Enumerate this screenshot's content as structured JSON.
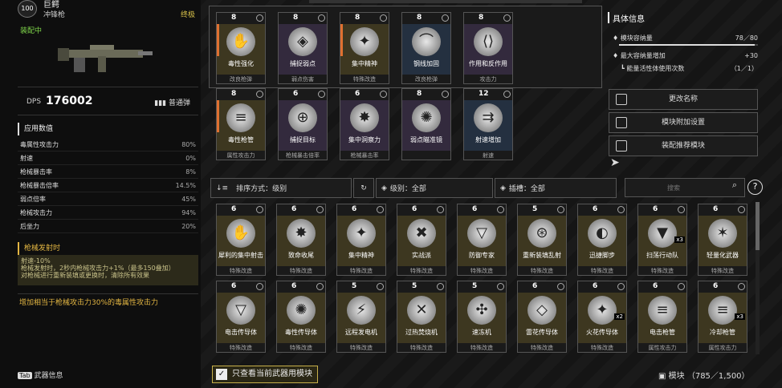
{
  "weapon": {
    "level": "100",
    "name": "巨鳄",
    "type": "冲锋枪",
    "rank": "终极",
    "equipped": "装配中",
    "dps_label": "DPS",
    "dps_value": "176002",
    "ammo": "普通弹"
  },
  "stats": {
    "title": "应用数值",
    "rows": [
      {
        "label": "毒属性攻击力",
        "value": "80%"
      },
      {
        "label": "射速",
        "value": "0%"
      },
      {
        "label": "枪械暴击率",
        "value": "8%"
      },
      {
        "label": "枪械暴击倍率",
        "value": "14.5%"
      },
      {
        "label": "弱点倍率",
        "value": "45%"
      },
      {
        "label": "枪械攻击力",
        "value": "94%"
      },
      {
        "label": "后坐力",
        "value": "20%"
      }
    ]
  },
  "fire": {
    "title": "枪械发射时",
    "line1": "射速-10%",
    "line2": "枪械发射时，2秒内枪械攻击力+1%（最多150叠加）",
    "line3": "对枪械进行重新装填或更换时，清除所有效果"
  },
  "poison_note": "增加相当于枪械攻击力30%的毒属性攻击力",
  "tab_key": "Tab",
  "tab_label": "武器信息",
  "equipped_mods": [
    {
      "cost": "8",
      "name": "毒性强化",
      "cat": "改良枪弹",
      "c": "gold",
      "icon": "✋"
    },
    {
      "cost": "8",
      "name": "捕捉弱点",
      "cat": "弱点伤害",
      "c": "purple",
      "icon": "◈"
    },
    {
      "cost": "8",
      "name": "集中精神",
      "cat": "特殊改造",
      "c": "gold",
      "icon": "✦"
    },
    {
      "cost": "8",
      "name": "钢线加固",
      "cat": "改良枪弹",
      "c": "blue",
      "icon": "⌒"
    },
    {
      "cost": "8",
      "name": "作用和反作用",
      "cat": "攻击力",
      "c": "purple",
      "icon": "⟨⟩"
    },
    {
      "cost": "8",
      "name": "毒性枪管",
      "cat": "属性攻击力",
      "c": "gold",
      "icon": "≡"
    },
    {
      "cost": "6",
      "name": "捕捉目标",
      "cat": "枪械暴击倍率",
      "c": "purple",
      "icon": "⊕"
    },
    {
      "cost": "6",
      "name": "集中洞察力",
      "cat": "枪械暴击率",
      "c": "purple",
      "icon": "✸"
    },
    {
      "cost": "8",
      "name": "弱点瞄准镜",
      "cat": "",
      "c": "purple",
      "icon": "✺"
    },
    {
      "cost": "12",
      "name": "射速增加",
      "cat": "射速",
      "c": "blue",
      "icon": "⇉"
    }
  ],
  "right": {
    "title": "具体信息",
    "capacity_label": "模块容纳量",
    "capacity_value": "78／80",
    "capacity_fill": 0.975,
    "max_label": "最大容纳量增加",
    "max_value": "+30",
    "energy_label": "能量活性体使用次数",
    "energy_value": "（1／1）"
  },
  "buttons": {
    "rename": "更改名称",
    "slot": "模块附加设置",
    "recommend": "装配推荐模块"
  },
  "toolbar": {
    "sort": "排序方式：级别",
    "level": "级别：全部",
    "socket": "插槽：全部"
  },
  "search": {
    "placeholder": "搜索"
  },
  "modules": [
    {
      "cost": "6",
      "name": "犀利的集中射击",
      "cat": "特殊改造",
      "c": "gold",
      "icon": "✋"
    },
    {
      "cost": "6",
      "name": "致命收尾",
      "cat": "特殊改造",
      "c": "gold",
      "icon": "✸"
    },
    {
      "cost": "6",
      "name": "集中精神",
      "cat": "特殊改造",
      "c": "gold",
      "icon": "✦"
    },
    {
      "cost": "6",
      "name": "实战派",
      "cat": "特殊改造",
      "c": "gold",
      "icon": "✖"
    },
    {
      "cost": "6",
      "name": "防御专家",
      "cat": "特殊改造",
      "c": "gold",
      "icon": "▽"
    },
    {
      "cost": "5",
      "name": "重新装填乱射",
      "cat": "特殊改造",
      "c": "gold",
      "icon": "⊛"
    },
    {
      "cost": "6",
      "name": "迅捷脚步",
      "cat": "特殊改造",
      "c": "gold",
      "icon": "◐"
    },
    {
      "cost": "6",
      "name": "扫荡行动队",
      "cat": "特殊改造",
      "c": "gold",
      "icon": "▼",
      "cnt": "x3"
    },
    {
      "cost": "6",
      "name": "轻量化武器",
      "cat": "特殊改造",
      "c": "gold",
      "icon": "✶"
    },
    {
      "cost": "6",
      "name": "电击传导体",
      "cat": "特殊改造",
      "c": "gold",
      "icon": "▽"
    },
    {
      "cost": "6",
      "name": "毒性传导体",
      "cat": "特殊改造",
      "c": "gold",
      "icon": "✺"
    },
    {
      "cost": "5",
      "name": "远程发电机",
      "cat": "特殊改造",
      "c": "gold",
      "icon": "⚡"
    },
    {
      "cost": "5",
      "name": "过热焚烧机",
      "cat": "特殊改造",
      "c": "gold",
      "icon": "✕"
    },
    {
      "cost": "5",
      "name": "速冻机",
      "cat": "特殊改造",
      "c": "gold",
      "icon": "✣"
    },
    {
      "cost": "6",
      "name": "雷花传导体",
      "cat": "特殊改造",
      "c": "gold",
      "icon": "◇"
    },
    {
      "cost": "6",
      "name": "火花传导体",
      "cat": "特殊改造",
      "c": "gold",
      "icon": "✦",
      "cnt": "x2"
    },
    {
      "cost": "6",
      "name": "电击枪管",
      "cat": "属性攻击力",
      "c": "gold",
      "icon": "≡"
    },
    {
      "cost": "6",
      "name": "冷却枪管",
      "cat": "属性攻击力",
      "c": "gold",
      "icon": "≡",
      "cnt": "x3"
    }
  ],
  "bottom_filter": "只查看当前武器用模块",
  "module_count_label": "模块",
  "module_count": "（785／1,500）",
  "colors": {
    "accent": "#c8b04a",
    "green": "#7fd64a",
    "orange": "#e07030"
  }
}
